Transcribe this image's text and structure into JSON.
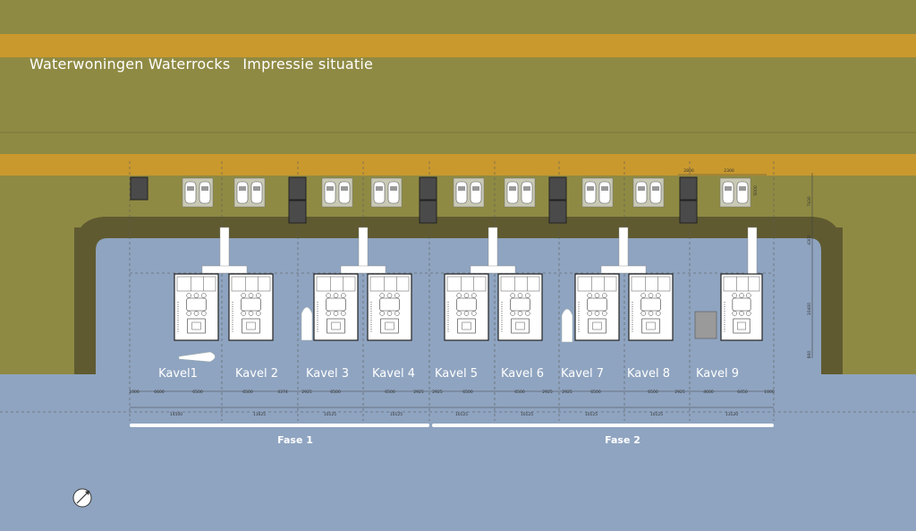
{
  "title": {
    "project": "Waterwoningen Waterrocks",
    "subtitle": "Impressie situatie"
  },
  "plots": [
    {
      "label": "Kavel1"
    },
    {
      "label": "Kavel 2"
    },
    {
      "label": "Kavel 3"
    },
    {
      "label": "Kavel 4"
    },
    {
      "label": "Kavel 5"
    },
    {
      "label": "Kavel 6"
    },
    {
      "label": "Kavel 7"
    },
    {
      "label": "Kavel 8"
    },
    {
      "label": "Kavel 9"
    }
  ],
  "phases": [
    {
      "label": "Fase 1"
    },
    {
      "label": "Fase 2"
    }
  ],
  "dimensions": {
    "plot_widths": [
      "14500",
      "11625",
      "10125",
      "10125",
      "10125",
      "10125",
      "10125",
      "10125",
      "13120"
    ],
    "detail": [
      "1000",
      "6600",
      "6500",
      "6500",
      "4374",
      "2925",
      "6500",
      "6500",
      "2925",
      "2925",
      "6500",
      "6500",
      "2925",
      "2925",
      "6500",
      "6500",
      "2925",
      "4600",
      "6450",
      "1000"
    ],
    "vertical": [
      "7430",
      "4300",
      "10400",
      "800"
    ],
    "parking": [
      "2800",
      "2300",
      "5000"
    ]
  },
  "colors": {
    "water": "#8fa4c0",
    "land": "#8f8a43",
    "road": "#c9992e",
    "quay": "#5f5a30",
    "house": "#ffffff"
  },
  "icons": [
    "north-arrow-icon",
    "boat-icon",
    "car-icon",
    "storage-box-icon"
  ]
}
